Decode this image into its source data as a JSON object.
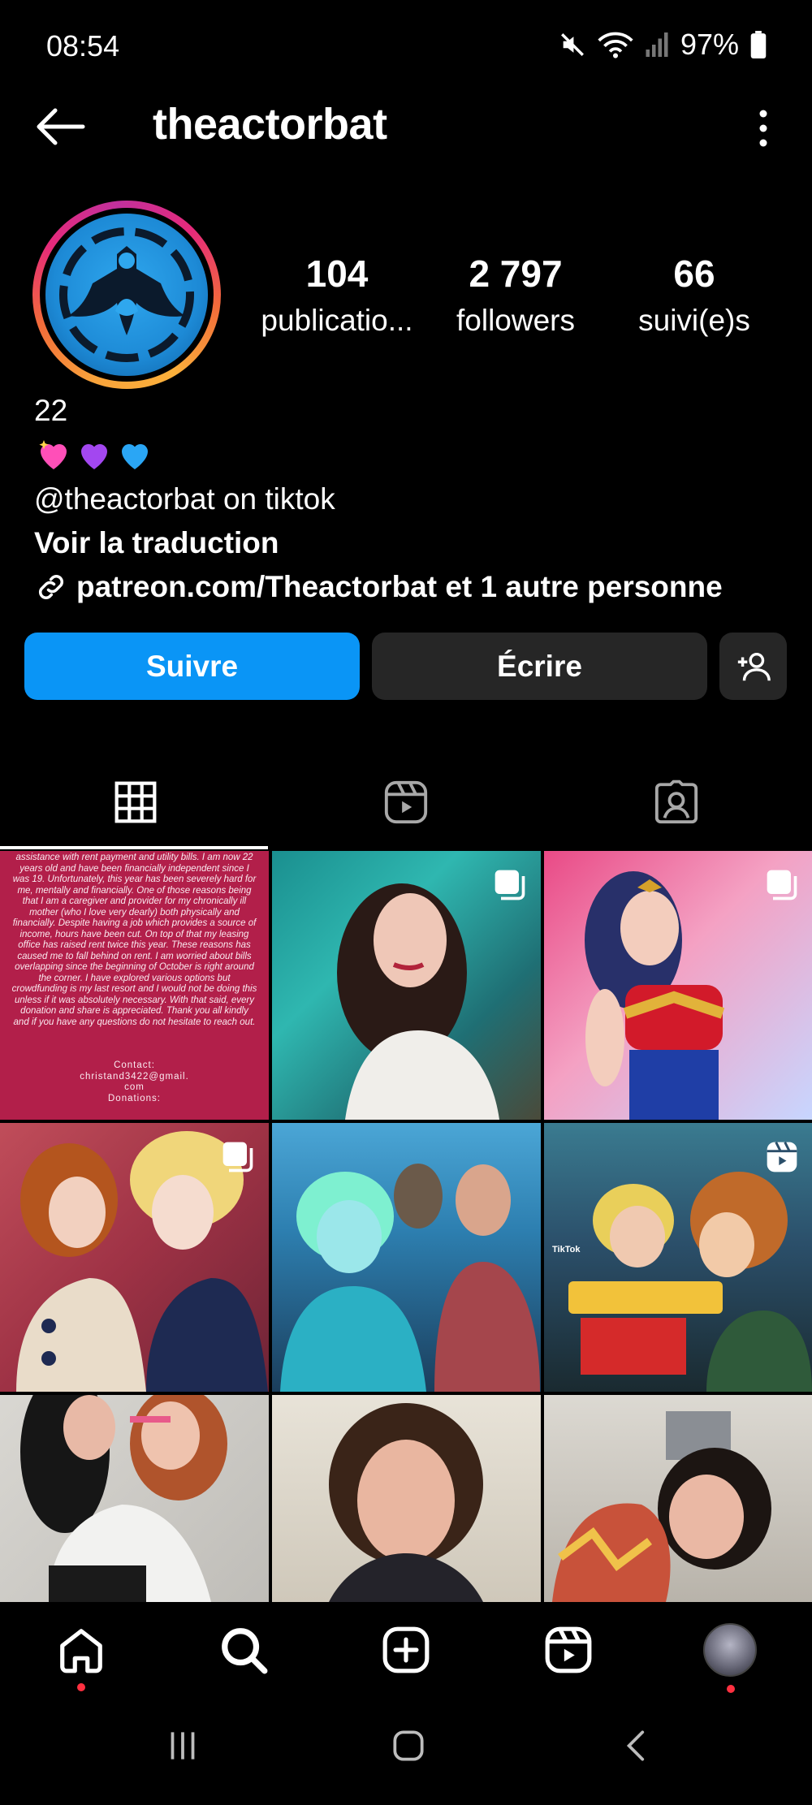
{
  "status_bar": {
    "time": "08:54",
    "battery": "97%"
  },
  "header": {
    "username": "theactorbat"
  },
  "stats": [
    {
      "value": "104",
      "label": "publicatio..."
    },
    {
      "value": "2 797",
      "label": "followers"
    },
    {
      "value": "66",
      "label": "suivi(e)s"
    }
  ],
  "bio": {
    "line1": "22",
    "line3": "@theactorbat on tiktok",
    "translate": "Voir la traduction",
    "link": "patreon.com/Theactorbat et 1 autre personne"
  },
  "buttons": {
    "follow": "Suivre",
    "write": "Écrire"
  },
  "post1_text": {
    "body": "assistance with rent payment and utility bills. I am now 22 years old and have been financially independent since I was 19. Unfortunately, this year has been severely hard for me, mentally and financially. One of those reasons being that I am a caregiver and provider for my chronically ill mother (who I love very dearly) both physically and financially. Despite having a job which provides a source of income, hours have been cut. On top of that my leasing office has raised rent twice this year. These reasons has caused me to fall behind on rent. I am worried about bills overlapping since the beginning of October is right around the corner. I have explored various options but crowdfunding is my last resort and I would not be doing this unless if it was absolutely necessary. With that said, every donation and share is appreciated. Thank you all kindly and if you have any questions do not hesitate to reach out.",
    "contact": "Contact:",
    "email": "christand3422@gmail.",
    "com": "com",
    "donations": "Donations:"
  },
  "post6_watermark": "TikTok",
  "colors": {
    "accent": "#0a95f6",
    "button_dark": "#262626",
    "notification": "#ff3040"
  }
}
